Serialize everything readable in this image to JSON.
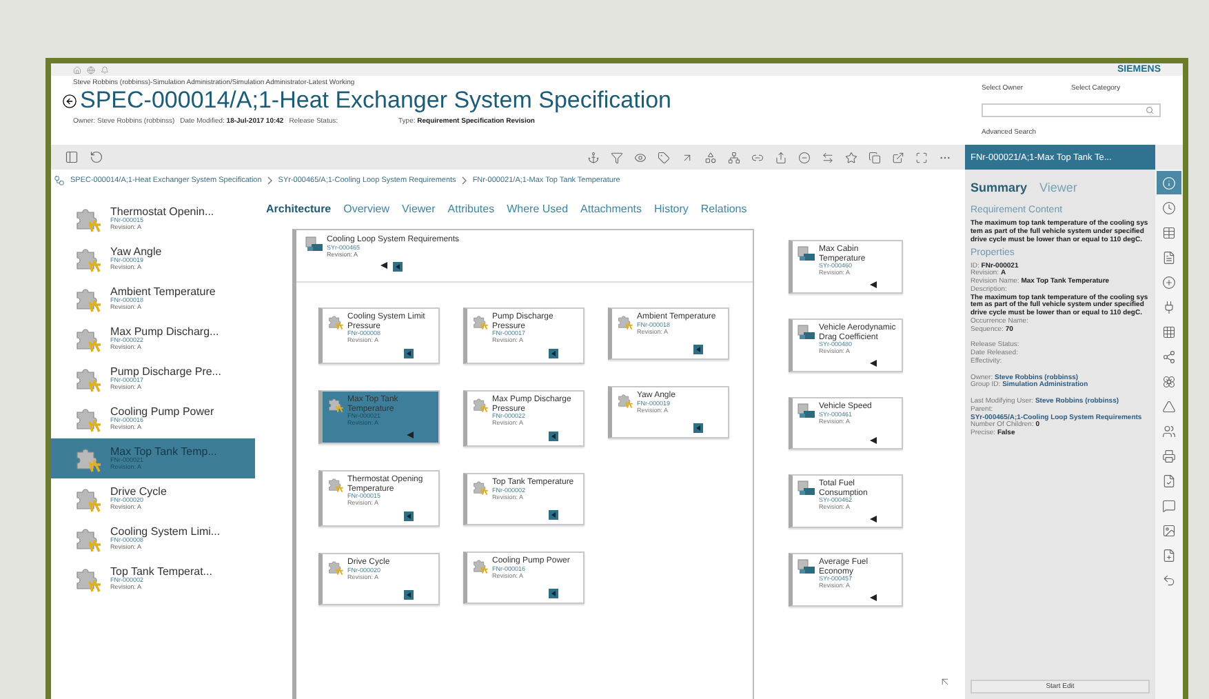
{
  "topbar": {
    "brand": "SIEMENS"
  },
  "header": {
    "context": "Steve Robbins (robbinss)-Simulation Administration/Simulation Administrator-Latest Working",
    "title": "SPEC-000014/A;1-Heat Exchanger System Specification",
    "meta": [
      {
        "label": "Owner:",
        "value": "Steve Robbins (robbinss)",
        "strong": false
      },
      {
        "label": "Date Modified:",
        "value": "18-Jul-2017 10:42",
        "strong": true
      },
      {
        "label": "Release Status:"
      }
    ],
    "type": {
      "label": "Type:",
      "value": "Requirement Specification Revision"
    }
  },
  "search": {
    "owner_label": "Select Owner",
    "category_label": "Select Category",
    "advanced": "Advanced Search"
  },
  "breadcrumb": [
    "SPEC-000014/A;1-Heat Exchanger System Specification",
    "SYr-000465/A;1-Cooling Loop System Requirements",
    "FNr-000021/A;1-Max Top Tank Temperature"
  ],
  "list": [
    {
      "name": "Thermostat Openin...",
      "id": "FNr-000015",
      "revision": "Revision: A",
      "selected": false
    },
    {
      "name": "Yaw Angle",
      "id": "FNr-000019",
      "revision": "Revision: A",
      "selected": false
    },
    {
      "name": "Ambient Temperature",
      "id": "FNr-000018",
      "revision": "Revision: A",
      "selected": false
    },
    {
      "name": "Max Pump Discharg...",
      "id": "FNr-000022",
      "revision": "Revision: A",
      "selected": false
    },
    {
      "name": "Pump Discharge Pre...",
      "id": "FNr-000017",
      "revision": "Revision: A",
      "selected": false
    },
    {
      "name": "Cooling Pump Power",
      "id": "FNr-000016",
      "revision": "Revision: A",
      "selected": false
    },
    {
      "name": "Max Top Tank Temp...",
      "id": "FNr-000021",
      "revision": "Revision: A",
      "selected": true
    },
    {
      "name": "Drive Cycle",
      "id": "FNr-000020",
      "revision": "Revision: A",
      "selected": false
    },
    {
      "name": "Cooling System Limi...",
      "id": "FNr-000008",
      "revision": "Revision: A",
      "selected": false
    },
    {
      "name": "Top Tank Temperat...",
      "id": "FNr-000002",
      "revision": "Revision: A",
      "selected": false
    }
  ],
  "tabs": [
    {
      "label": "Architecture",
      "selected": true
    },
    {
      "label": "Overview",
      "selected": false
    },
    {
      "label": "Viewer",
      "selected": false
    },
    {
      "label": "Attributes",
      "selected": false
    },
    {
      "label": "Where Used",
      "selected": false
    },
    {
      "label": "Attachments",
      "selected": false
    },
    {
      "label": "History",
      "selected": false
    },
    {
      "label": "Relations",
      "selected": false
    }
  ],
  "architecture": {
    "parent": {
      "kind": "system",
      "title": "Cooling Loop System Requirements",
      "id": "SYr-000465",
      "revision": "Revision: A",
      "back": true,
      "expand": true,
      "selected": false
    },
    "columns": [
      [
        {
          "kind": "function",
          "title": "Cooling System Limit Pressure",
          "id": "FNr-000008",
          "revision": "Revision: A",
          "back": false,
          "expand": true,
          "selected": false
        },
        {
          "kind": "function",
          "title": "Max Top Tank Temperature",
          "id": "FNr-000021",
          "revision": "Revision: A",
          "back": true,
          "expand": false,
          "selected": true
        },
        {
          "kind": "function",
          "title": "Thermostat Opening Temperature",
          "id": "FNr-000015",
          "revision": "Revision: A",
          "back": false,
          "expand": true,
          "selected": false
        },
        {
          "kind": "function",
          "title": "Drive Cycle",
          "id": "FNr-000020",
          "revision": "Revision: A",
          "back": false,
          "expand": true,
          "selected": false
        }
      ],
      [
        {
          "kind": "function",
          "title": "Pump Discharge Pressure",
          "id": "FNr-000017",
          "revision": "Revision: A",
          "back": false,
          "expand": true,
          "selected": false
        },
        {
          "kind": "function",
          "title": "Max Pump Discharge Pressure",
          "id": "FNr-000022",
          "revision": "Revision: A",
          "back": false,
          "expand": true,
          "selected": false
        },
        {
          "kind": "function",
          "title": "Top Tank Temperature",
          "id": "FNr-000002",
          "revision": "Revision: A",
          "back": false,
          "expand": true,
          "selected": false
        },
        {
          "kind": "function",
          "title": "Cooling Pump Power",
          "id": "FNr-000016",
          "revision": "Revision: A",
          "back": false,
          "expand": true,
          "selected": false
        }
      ],
      [
        {
          "kind": "function",
          "title": "Ambient Temperature",
          "id": "FNr-000018",
          "revision": "Revision: A",
          "back": false,
          "expand": true,
          "selected": false
        },
        {
          "kind": "function",
          "title": "Yaw Angle",
          "id": "FNr-000019",
          "revision": "Revision: A",
          "back": false,
          "expand": true,
          "selected": false
        }
      ]
    ],
    "related": [
      {
        "kind": "system",
        "title": "Max Cabin Temperature",
        "id": "SYr-000460",
        "revision": "Revision: A",
        "back": true,
        "expand": false,
        "selected": false
      },
      {
        "kind": "system",
        "title": "Vehicle Aerodynamic Drag Coefficient",
        "id": "SYr-000480",
        "revision": "Revision: A",
        "back": true,
        "expand": false,
        "selected": false
      },
      {
        "kind": "system",
        "title": "Vehicle Speed",
        "id": "SYr-000461",
        "revision": "Revision: A",
        "back": true,
        "expand": false,
        "selected": false
      },
      {
        "kind": "system",
        "title": "Total Fuel Consumption",
        "id": "SYr-000462",
        "revision": "Revision: A",
        "back": true,
        "expand": false,
        "selected": false
      },
      {
        "kind": "system",
        "title": "Average Fuel Economy",
        "id": "SYr-000457",
        "revision": "Revision: A",
        "back": true,
        "expand": false,
        "selected": false
      }
    ]
  },
  "panel": {
    "header": "FNr-000021/A;1-Max Top Tank Te...",
    "tabs": [
      {
        "label": "Summary",
        "selected": true
      },
      {
        "label": "Viewer",
        "selected": false
      }
    ],
    "content_heading": "Requirement Content",
    "content": "The maximum top tank temperature of the cooling system as part of the full vehicle system under specified drive cycle must be lower than or equal to 110 degC.",
    "properties_heading": "Properties",
    "groups": [
      [
        {
          "kind": "inline",
          "label": "ID:",
          "value": "FNr-000021",
          "link": false
        },
        {
          "kind": "inline",
          "label": "Revision:",
          "value": "A",
          "link": false
        },
        {
          "kind": "inline",
          "label": "Revision Name:",
          "value": "Max Top Tank Temperature",
          "link": false
        },
        {
          "kind": "block",
          "label": "Description:",
          "value": "The maximum top tank temperature of the cooling system as part of the full vehicle system under specified drive cycle must be lower than or equal to 110 degC.",
          "link": false
        },
        {
          "kind": "inline",
          "label": "Occurrence Name:"
        },
        {
          "kind": "inline",
          "label": "Sequence:",
          "value": "70",
          "link": false
        }
      ],
      [
        {
          "kind": "inline",
          "label": "Release Status:"
        },
        {
          "kind": "inline",
          "label": "Date Released:"
        },
        {
          "kind": "inline",
          "label": "Effectivity:"
        }
      ],
      [
        {
          "kind": "inline",
          "label": "Owner:",
          "value": "Steve Robbins (robbinss)",
          "link": true
        },
        {
          "kind": "inline",
          "label": "Group ID:",
          "value": "Simulation Administration",
          "link": true
        }
      ],
      [
        {
          "kind": "inline",
          "label": "Last Modifying User:",
          "value": "Steve Robbins (robbinss)",
          "link": true
        },
        {
          "kind": "block",
          "label": "Parent:",
          "value": "SYr-000465/A;1-Cooling Loop System Requirements",
          "link": true
        },
        {
          "kind": "inline",
          "label": "Number Of Children:",
          "value": "0",
          "link": false
        },
        {
          "kind": "inline",
          "label": "Precise:",
          "value": "False",
          "link": false
        }
      ]
    ],
    "button": "Start Edit"
  },
  "side_tools": [
    {
      "selected": true
    },
    {
      "selected": false
    },
    {
      "selected": false
    },
    {
      "selected": false
    },
    {
      "selected": false
    },
    {
      "selected": false
    },
    {
      "selected": false
    },
    {
      "selected": false
    },
    {
      "selected": false
    },
    {
      "selected": false
    },
    {
      "selected": false
    },
    {
      "selected": false
    },
    {
      "selected": false
    },
    {
      "selected": false
    },
    {
      "selected": false
    },
    {
      "selected": false
    },
    {
      "selected": false
    }
  ]
}
